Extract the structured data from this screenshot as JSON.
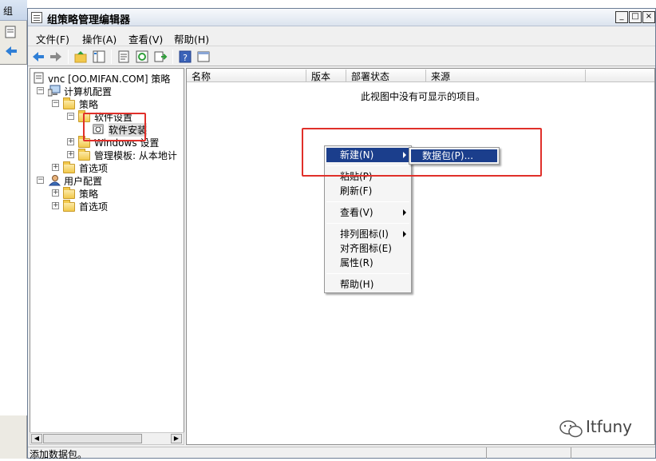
{
  "window": {
    "title": "组策略管理编辑器"
  },
  "background_window": {
    "title_fragment": "组"
  },
  "menu": {
    "items": [
      "文件(F)",
      "操作(A)",
      "查看(V)",
      "帮助(H)"
    ]
  },
  "toolbar": {
    "buttons": [
      "back-icon",
      "forward-icon",
      "up-folder-icon",
      "show-tree-icon",
      "properties-icon",
      "refresh-icon",
      "export-icon",
      "help-icon",
      "view-icon"
    ]
  },
  "tree": {
    "root": "vnc [OO.MIFAN.COM] 策略",
    "computer_config": "计算机配置",
    "policies": "策略",
    "software_settings": "软件设置",
    "software_install": "软件安装",
    "windows_settings": "Windows 设置",
    "admin_templates": "管理模板: 从本地计",
    "preferences": "首选项",
    "user_config": "用户配置",
    "user_policies": "策略",
    "user_preferences": "首选项"
  },
  "list": {
    "columns": [
      "名称",
      "版本",
      "部署状态",
      "来源"
    ],
    "empty_message": "此视图中没有可显示的项目。"
  },
  "context_menu": {
    "new": "新建(N)",
    "paste": "粘贴(P)",
    "refresh": "刷新(F)",
    "view": "查看(V)",
    "arrange_icons": "排列图标(I)",
    "align_icons": "对齐图标(E)",
    "properties": "属性(R)",
    "help": "帮助(H)"
  },
  "submenu": {
    "package": "数据包(P)..."
  },
  "status": {
    "text": "添加数据包。"
  },
  "watermark": {
    "text": "Itfuny"
  },
  "colors": {
    "highlight": "#1b3e8c",
    "annotation": "#e0302a"
  }
}
